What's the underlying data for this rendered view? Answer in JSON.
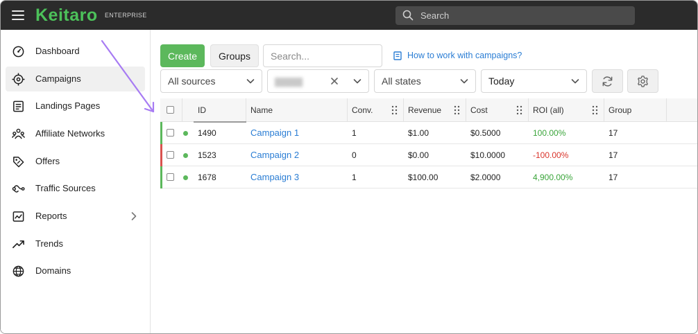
{
  "app": {
    "logo": "Keitaro",
    "edition": "ENTERPRISE",
    "search_placeholder": "Search"
  },
  "sidebar": {
    "items": [
      {
        "label": "Dashboard",
        "icon": "dashboard-icon"
      },
      {
        "label": "Campaigns",
        "icon": "target-icon",
        "active": true
      },
      {
        "label": "Landings Pages",
        "icon": "landing-page-icon"
      },
      {
        "label": "Affiliate Networks",
        "icon": "affiliate-network-icon"
      },
      {
        "label": "Offers",
        "icon": "tag-icon"
      },
      {
        "label": "Traffic Sources",
        "icon": "traffic-source-icon"
      },
      {
        "label": "Reports",
        "icon": "report-icon",
        "has_submenu": true
      },
      {
        "label": "Trends",
        "icon": "trend-icon"
      },
      {
        "label": "Domains",
        "icon": "globe-icon"
      }
    ]
  },
  "toolbar": {
    "create_label": "Create",
    "groups_label": "Groups",
    "search_placeholder": "Search...",
    "help_link": "How to work with campaigns?"
  },
  "filters": {
    "sources": "All sources",
    "states": "All states",
    "period": "Today"
  },
  "table": {
    "columns": [
      "ID",
      "Name",
      "Conv.",
      "Revenue",
      "Cost",
      "ROI (all)",
      "Group"
    ],
    "rows": [
      {
        "id": "1490",
        "name": "Campaign 1",
        "conv": "1",
        "revenue": "$1.00",
        "cost": "$0.5000",
        "roi": "100.00%",
        "group": "17",
        "status": "positive"
      },
      {
        "id": "1523",
        "name": "Campaign 2",
        "conv": "0",
        "revenue": "$0.00",
        "cost": "$10.0000",
        "roi": "-100.00%",
        "group": "17",
        "status": "negative"
      },
      {
        "id": "1678",
        "name": "Campaign 3",
        "conv": "1",
        "revenue": "$100.00",
        "cost": "$2.0000",
        "roi": "4,900.00%",
        "group": "17",
        "status": "positive"
      }
    ]
  },
  "colors": {
    "brand_green": "#4cc15a",
    "positive": "#5cb85c",
    "negative": "#d9534f",
    "link": "#2a7dd4",
    "annotation_arrow": "#a77bf3"
  }
}
